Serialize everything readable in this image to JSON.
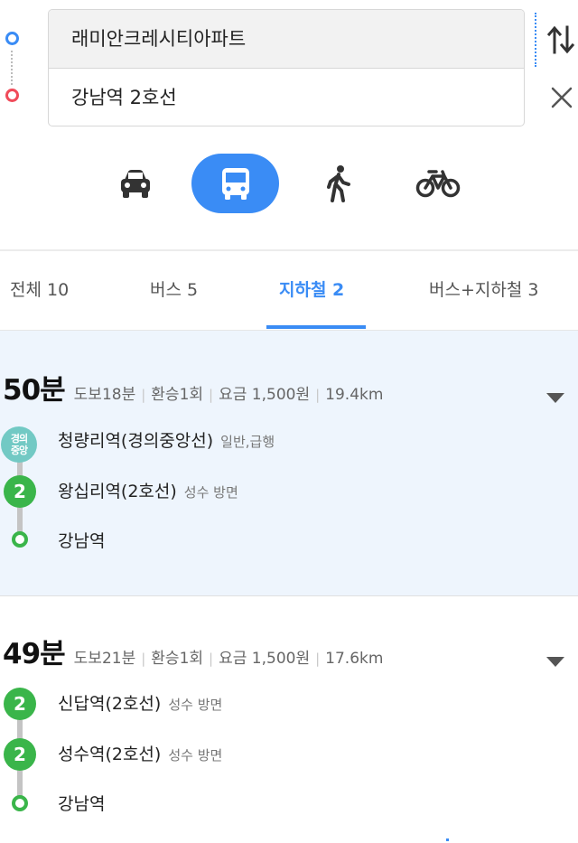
{
  "search": {
    "start": "래미안크레시티아파트",
    "end": "강남역 2호선"
  },
  "modes": [
    {
      "name": "car-icon",
      "active": false
    },
    {
      "name": "bus-icon",
      "active": true
    },
    {
      "name": "walk-icon",
      "active": false
    },
    {
      "name": "bike-icon",
      "active": false
    }
  ],
  "tabs": [
    {
      "label": "전체 10",
      "active": false
    },
    {
      "label": "버스 5",
      "active": false
    },
    {
      "label": "지하철 2",
      "active": true
    },
    {
      "label": "버스+지하철 3",
      "active": false
    }
  ],
  "routes": [
    {
      "time": "50분",
      "walk": "도보18분",
      "transfer": "환승1회",
      "fare": "요금 1,500원",
      "distance": "19.4km",
      "stops": [
        {
          "line": "경의중앙",
          "line_top": "경의",
          "line_bottom": "중앙",
          "name": "청량리역(경의중앙선)",
          "sub": "일반,급행"
        },
        {
          "line": "2",
          "name": "왕십리역(2호선)",
          "sub": "성수 방면"
        },
        {
          "line": "end",
          "name": "강남역",
          "sub": ""
        }
      ]
    },
    {
      "time": "49분",
      "walk": "도보21분",
      "transfer": "환승1회",
      "fare": "요금 1,500원",
      "distance": "17.6km",
      "stops": [
        {
          "line": "2",
          "name": "신답역(2호선)",
          "sub": "성수 방면"
        },
        {
          "line": "2",
          "name": "성수역(2호선)",
          "sub": "성수 방면"
        },
        {
          "line": "end",
          "name": "강남역",
          "sub": ""
        }
      ]
    }
  ],
  "colors": {
    "accent": "#3a8cf5",
    "start_dot": "#3a8cf5",
    "end_dot": "#f04b5a",
    "line2": "#3ab54a",
    "gyeongui": "#72c9c4",
    "selected_route_bg": "#eef5fd"
  }
}
